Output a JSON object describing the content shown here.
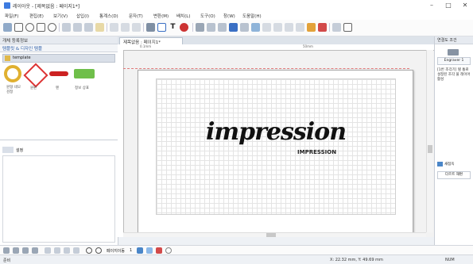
{
  "window": {
    "title": "레이아웃 - [제목없음 : 페이지1*]",
    "minimize": "–",
    "maximize": "□",
    "close": "✕"
  },
  "menu": [
    "파일(F)",
    "편집(E)",
    "보기(V)",
    "삽입(I)",
    "통계스(D)",
    "문자(T)",
    "변환(M)",
    "배치(L)",
    "도구(O)",
    "창(W)",
    "도움말(H)"
  ],
  "left_panel": {
    "title": "개체 등록정보",
    "section_title": "템플릿 & 디자인 템플",
    "category": "template",
    "thumbnails": [
      {
        "label": "원형 네모검정"
      },
      {
        "label": "원판"
      },
      {
        "label": "펜"
      },
      {
        "label": "정보 상표"
      }
    ],
    "lower_label": "설정"
  },
  "document": {
    "tab_label": "제목없음 : 페이지1*",
    "ruler_marks": [
      "0.1mm",
      "50mm"
    ],
    "logo_text": "impression",
    "logo_subtext": "IMPRESSION"
  },
  "right_panel": {
    "header": "연결도 조건",
    "device_label": "Engraver 1",
    "note": "[1번 조각기] 텔 통로 설정된 조각 물 레이어 활성",
    "link_button": "새점옥",
    "restore_button": "다르트 재편"
  },
  "bottom_bar": {
    "page_selector": "페이지이동",
    "zoom_label": "1"
  },
  "status": {
    "mode": "준비",
    "coords": "X: 22.32 mm, Y: 49.69 mm",
    "numlock": "NUM"
  }
}
